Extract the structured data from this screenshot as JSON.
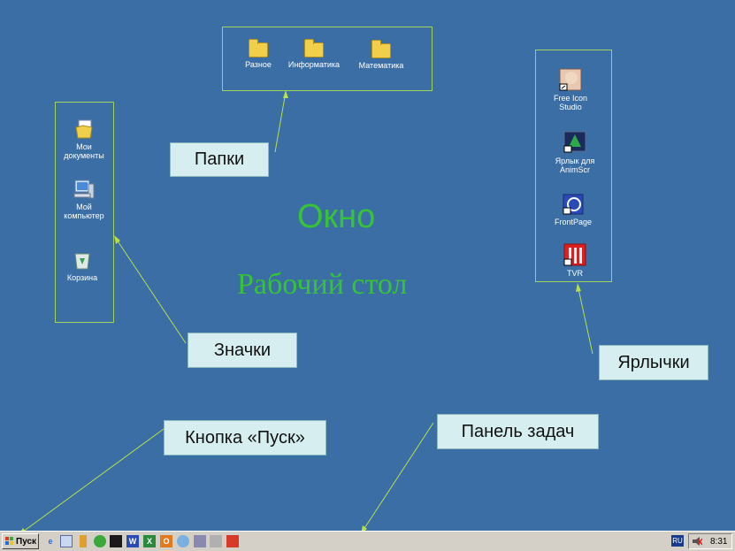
{
  "desktop": {
    "title": "Окно",
    "subtitle": "Рабочий стол",
    "background": "#3a6ea5"
  },
  "folders": [
    {
      "label": "Разное",
      "icon": "folder-icon"
    },
    {
      "label": "Информатика",
      "icon": "folder-icon"
    },
    {
      "label": "Математика",
      "icon": "folder-icon"
    }
  ],
  "system_icons": [
    {
      "label": "Мои документы",
      "icon": "my-documents-icon"
    },
    {
      "label": "Мой компьютер",
      "icon": "my-computer-icon"
    },
    {
      "label": "Корзина",
      "icon": "recycle-bin-icon"
    }
  ],
  "shortcuts": [
    {
      "label": "Free Icon Studio",
      "icon": "free-icon-studio-icon"
    },
    {
      "label": "Ярлык для AnimScr",
      "icon": "animscr-icon"
    },
    {
      "label": "FrontPage",
      "icon": "frontpage-icon"
    },
    {
      "label": "TVR",
      "icon": "tvr-icon"
    }
  ],
  "callouts": {
    "folders": "Папки",
    "icons": "Значки",
    "shortcuts": "Ярлычки",
    "start_button": "Кнопка «Пуск»",
    "taskbar": "Панель задач"
  },
  "taskbar": {
    "start_label": "Пуск",
    "language": "RU",
    "clock": "8:31",
    "quick_launch": [
      "ie-icon",
      "book-icon",
      "tool-icon",
      "network-icon",
      "dark-app-icon",
      "word-icon",
      "excel-icon",
      "office-icon",
      "powerpoint-icon",
      "paint-icon",
      "calc-icon",
      "lock-icon",
      "ppt-icon"
    ]
  },
  "colors": {
    "frame": "#9fd35c",
    "callout_bg": "#d6eef0",
    "title_text": "#36c436"
  }
}
